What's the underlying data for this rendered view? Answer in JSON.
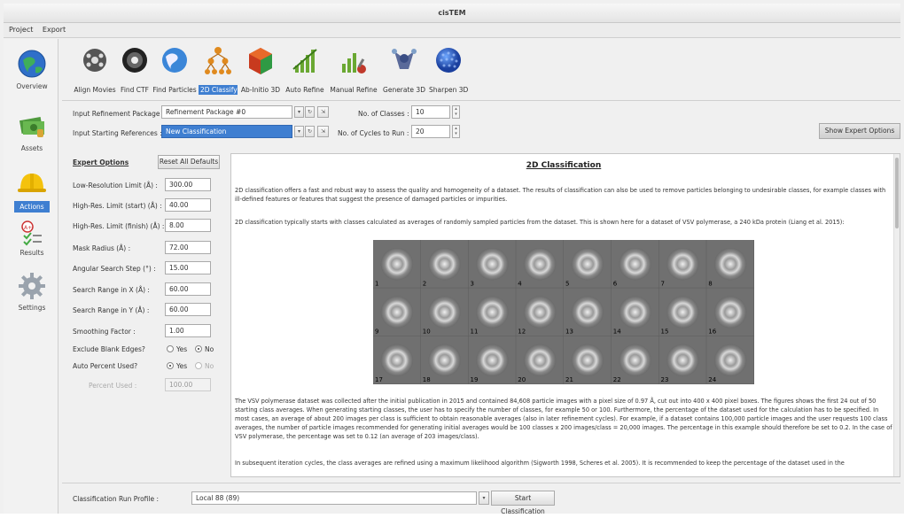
{
  "window": {
    "title": "cisTEM"
  },
  "menu": {
    "items": [
      "Project",
      "Export"
    ]
  },
  "nav": {
    "items": [
      {
        "label": "Overview",
        "icon": "globe-icon",
        "active": false
      },
      {
        "label": "Assets",
        "icon": "money-stack-icon",
        "active": false
      },
      {
        "label": "Actions",
        "icon": "hard-hat-icon",
        "active": true
      },
      {
        "label": "Results",
        "icon": "checklist-icon",
        "active": false
      },
      {
        "label": "Settings",
        "icon": "gear-icon",
        "active": false
      }
    ]
  },
  "toolbar": {
    "items": [
      {
        "label": "Align Movies",
        "icon": "film-reel-icon",
        "selected": false
      },
      {
        "label": "Find CTF",
        "icon": "ctf-ring-icon",
        "selected": false
      },
      {
        "label": "Find Particles",
        "icon": "globe-icon",
        "selected": false
      },
      {
        "label": "2D Classify",
        "icon": "hierarchy-icon",
        "selected": true
      },
      {
        "label": "Ab-Initio 3D",
        "icon": "cube-icon",
        "selected": false
      },
      {
        "label": "Auto Refine",
        "icon": "chart-icon",
        "selected": false
      },
      {
        "label": "Manual Refine",
        "icon": "chart-tools-icon",
        "selected": false
      },
      {
        "label": "Generate 3D",
        "icon": "molecule-icon",
        "selected": false
      },
      {
        "label": "Sharpen 3D",
        "icon": "sphere-icon",
        "selected": false
      }
    ]
  },
  "inputs": {
    "refinement_package_label": "Input Refinement Package :",
    "refinement_package_value": "Refinement Package #0",
    "starting_references_label": "Input Starting References :",
    "starting_references_value": "New Classification",
    "num_classes_label": "No. of Classes :",
    "num_classes_value": "10",
    "num_cycles_label": "No. of Cycles to Run :",
    "num_cycles_value": "20",
    "show_expert_label": "Show Expert Options"
  },
  "expert": {
    "title": "Expert Options",
    "reset_label": "Reset All Defaults",
    "fields": [
      {
        "label": "Low-Resolution Limit (Å) :",
        "value": "300.00"
      },
      {
        "label": "High-Res. Limit (start)  (Å) :",
        "value": "40.00"
      },
      {
        "label": "High-Res. Limit (finish) (Å) :",
        "value": "8.00"
      },
      {
        "label": "Mask Radius (Å) :",
        "value": "72.00"
      },
      {
        "label": "Angular Search Step (°) :",
        "value": "15.00"
      },
      {
        "label": "Search Range in X (Å) :",
        "value": "60.00"
      },
      {
        "label": "Search Range in Y (Å) :",
        "value": "60.00"
      },
      {
        "label": "Smoothing Factor :",
        "value": "1.00"
      }
    ],
    "exclude_blank_label": "Exclude Blank Edges?",
    "auto_percent_label": "Auto Percent Used?",
    "yes": "Yes",
    "no": "No",
    "percent_used_label": "Percent Used :",
    "percent_used_value": "100.00"
  },
  "info": {
    "title": "2D Classification",
    "p1": "2D classification offers a fast and robust way to assess the quality and homogeneity of a dataset. The results of classification can also be used to remove particles belonging to undesirable classes, for example classes with ill-defined features or features that suggest the presence of damaged particles or impurities.",
    "p2": "2D classification typically starts with classes calculated as averages of randomly sampled particles from the dataset. This is shown here for a dataset of VSV polymerase, a 240 kDa protein (Liang et al. 2015):",
    "figure_labels": [
      "1",
      "2",
      "3",
      "4",
      "5",
      "6",
      "7",
      "8",
      "9",
      "10",
      "11",
      "12",
      "13",
      "14",
      "15",
      "16",
      "17",
      "18",
      "19",
      "20",
      "21",
      "22",
      "23",
      "24"
    ],
    "p3": "The VSV polymerase dataset was collected after the initial publication in 2015 and contained 84,608 particle images with a pixel size of 0.97 Å, cut out into 400 x 400 pixel boxes. The figures shows the first 24 out of 50 starting class averages. When generating starting classes, the user has to specify the number of classes, for example 50 or 100. Furthermore, the percentage of the dataset used for the calculation has to be specified. In most cases, an average of about 200 images per class is sufficient to obtain reasonable averages (also in later refinement cycles). For example, if a dataset contains 100,000 particle images and the user requests 100 class averages, the number of particle images recommended for generating initial averages would be 100 classes x 200 images/class = 20,000 images. The percentage in this example should therefore be set to 0.2. In the case of VSV polymerase, the percentage was set to 0.12 (an average of 203 images/class).",
    "p4": "In subsequent iteration cycles, the class averages are refined using a maximum likelihood algorithm (Sigworth 1998, Scheres et al. 2005). It is recommended to keep the percentage of the dataset used in the"
  },
  "bottom": {
    "run_profile_label": "Classification Run Profile :",
    "run_profile_value": "Local 88 (89)",
    "start_label": "Start Classification"
  }
}
